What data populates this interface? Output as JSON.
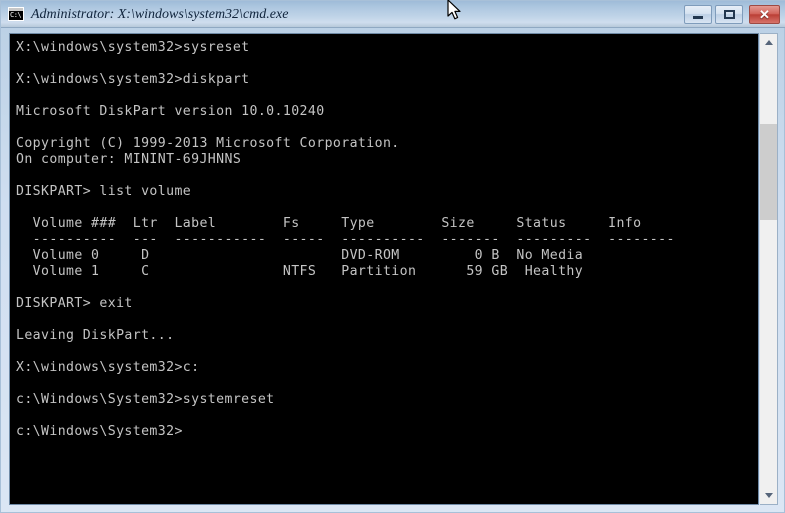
{
  "window": {
    "title": "Administrator: X:\\windows\\system32\\cmd.exe",
    "icon_name": "cmd-console-icon",
    "icon_glyph": "C:\\",
    "colors": {
      "titlebar_top": "#9fbbd8",
      "titlebar_bottom": "#b7c9da",
      "console_background": "#000000",
      "console_text": "#c4c4c4",
      "close_button": "#bb3f36"
    }
  },
  "titlebar_buttons": {
    "minimize_label": "–",
    "maximize_label": "□",
    "close_label": "✕"
  },
  "scrollbar": {
    "up_arrow_label": "▲",
    "down_arrow_label": "▼"
  },
  "console": {
    "lines": [
      "X:\\windows\\system32>sysreset",
      "",
      "X:\\windows\\system32>diskpart",
      "",
      "Microsoft DiskPart version 10.0.10240",
      "",
      "Copyright (C) 1999-2013 Microsoft Corporation.",
      "On computer: MININT-69JHNNS",
      "",
      "DISKPART> list volume",
      "",
      "  Volume ###  Ltr  Label        Fs     Type        Size     Status     Info",
      "  ----------  ---  -----------  -----  ----------  -------  ---------  --------",
      "  Volume 0     D                       DVD-ROM         0 B  No Media",
      "  Volume 1     C                NTFS   Partition      59 GB  Healthy",
      "",
      "DISKPART> exit",
      "",
      "Leaving DiskPart...",
      "",
      "X:\\windows\\system32>c:",
      "",
      "c:\\Windows\\System32>systemreset",
      "",
      "c:\\Windows\\System32>"
    ],
    "commands": [
      "sysreset",
      "diskpart",
      "list volume",
      "exit",
      "c:",
      "systemreset"
    ],
    "diskpart": {
      "version": "Microsoft DiskPart version 10.0.10240",
      "copyright": "Copyright (C) 1999-2013 Microsoft Corporation.",
      "computer": "On computer: MININT-69JHNNS",
      "leaving_message": "Leaving DiskPart...",
      "prompt": "DISKPART>"
    },
    "volume_table": {
      "headers": [
        "Volume ###",
        "Ltr",
        "Label",
        "Fs",
        "Type",
        "Size",
        "Status",
        "Info"
      ],
      "rows": [
        {
          "volume": "Volume 0",
          "ltr": "D",
          "label": "",
          "fs": "",
          "type": "DVD-ROM",
          "size": "0 B",
          "status": "No Media",
          "info": ""
        },
        {
          "volume": "Volume 1",
          "ltr": "C",
          "label": "",
          "fs": "NTFS",
          "type": "Partition",
          "size": "59 GB",
          "status": "Healthy",
          "info": ""
        }
      ]
    },
    "prompts": {
      "winpe": "X:\\windows\\system32>",
      "local": "c:\\Windows\\System32>"
    }
  }
}
